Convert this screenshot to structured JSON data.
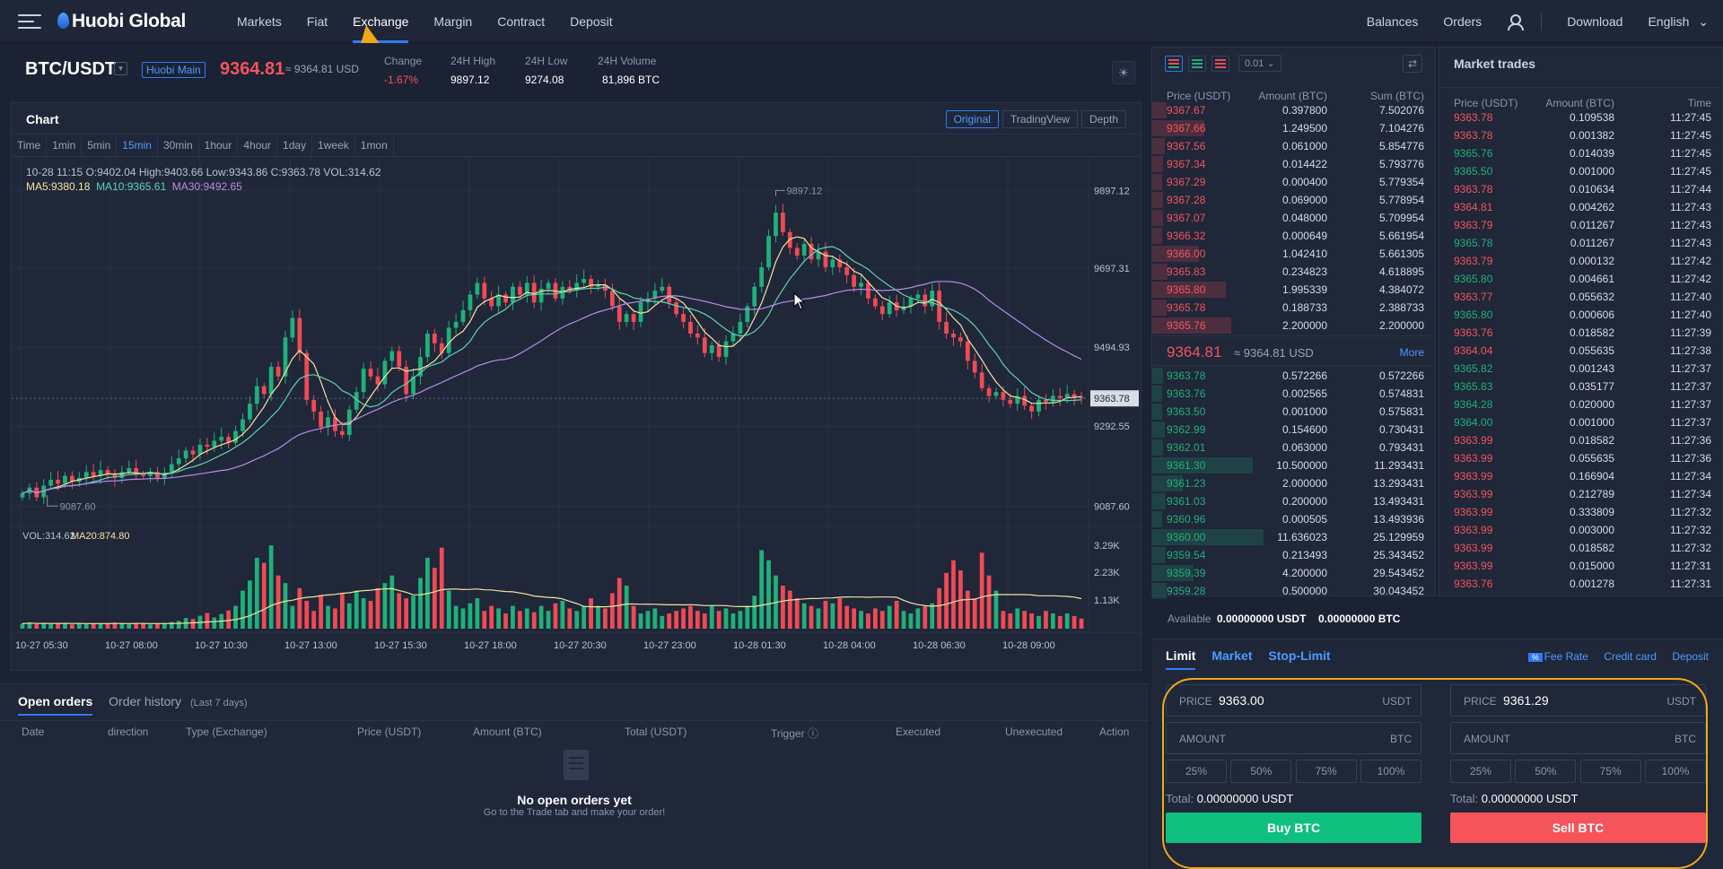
{
  "nav": {
    "logo": "Huobi Global",
    "items": [
      "Markets",
      "Fiat",
      "Exchange",
      "Margin",
      "Contract",
      "Deposit"
    ],
    "active": "Exchange",
    "right": [
      "Balances",
      "Orders",
      "Download",
      "English"
    ]
  },
  "ticker": {
    "pair": "BTC/USDT",
    "badge": "Huobi Main",
    "price": "9364.81",
    "usd": "≈ 9364.81 USD",
    "change_label": "Change",
    "change_value": "-1.67%",
    "high_label": "24H High",
    "high_value": "9897.12",
    "low_label": "24H Low",
    "low_value": "9274.08",
    "vol_label": "24H Volume",
    "vol_value": "81,896 BTC"
  },
  "chart": {
    "title": "Chart",
    "tabs": [
      "Original",
      "TradingView",
      "Depth"
    ],
    "intervals": [
      "Time",
      "1min",
      "5min",
      "15min",
      "30min",
      "1hour",
      "4hour",
      "1day",
      "1week",
      "1mon"
    ],
    "active_interval": "15min",
    "ohlc": "10-28 11:15   O:9402.04  High:9403.66  Low:9343.86  C:9363.78  VOL:314.62",
    "ma5": "MA5:9380.18",
    "ma10": "MA10:9365.61",
    "ma30": "MA30:9492.65",
    "vol_label": "VOL:314.62",
    "ma20_label": "MA20:874.80",
    "colors": {
      "up": "#20b07a",
      "down": "#f04a55",
      "ma5": "#f2e6a0",
      "ma10": "#5fd3b5",
      "ma30": "#b98be8"
    }
  },
  "chart_data": {
    "type": "candlestick",
    "title": "",
    "y_ticks": [
      9897.12,
      9697.31,
      9494.93,
      9292.55,
      9087.6
    ],
    "ylim": [
      9040,
      9960
    ],
    "vol_ticks": [
      "3.29K",
      "2.23K",
      "1.13K"
    ],
    "x_ticks": [
      "10-27 05:30",
      "10-27 08:00",
      "10-27 10:30",
      "10-27 13:00",
      "10-27 15:30",
      "10-27 18:00",
      "10-27 20:30",
      "10-27 23:00",
      "10-28 01:30",
      "10-28 04:00",
      "10-28 06:30",
      "10-28 09:00"
    ],
    "annotations": {
      "high": "9897.12",
      "low": "9087.60",
      "last": "9363.78"
    },
    "close": [
      9120,
      9135,
      9110,
      9140,
      9155,
      9145,
      9165,
      9150,
      9160,
      9175,
      9165,
      9180,
      9170,
      9160,
      9175,
      9185,
      9170,
      9165,
      9175,
      9160,
      9170,
      9195,
      9210,
      9230,
      9220,
      9245,
      9240,
      9255,
      9265,
      9250,
      9280,
      9310,
      9350,
      9395,
      9375,
      9445,
      9420,
      9520,
      9570,
      9480,
      9360,
      9330,
      9290,
      9315,
      9280,
      9270,
      9335,
      9380,
      9440,
      9420,
      9400,
      9460,
      9485,
      9445,
      9375,
      9420,
      9470,
      9530,
      9505,
      9480,
      9545,
      9560,
      9590,
      9630,
      9660,
      9620,
      9600,
      9630,
      9610,
      9650,
      9630,
      9660,
      9610,
      9645,
      9660,
      9620,
      9650,
      9640,
      9660,
      9670,
      9650,
      9655,
      9640,
      9600,
      9560,
      9580,
      9560,
      9610,
      9620,
      9640,
      9650,
      9610,
      9580,
      9560,
      9530,
      9520,
      9480,
      9500,
      9470,
      9510,
      9530,
      9560,
      9600,
      9650,
      9700,
      9780,
      9840,
      9790,
      9750,
      9730,
      9760,
      9720,
      9740,
      9700,
      9720,
      9700,
      9680,
      9650,
      9660,
      9620,
      9600,
      9580,
      9610,
      9590,
      9600,
      9620,
      9630,
      9600,
      9640,
      9560,
      9530,
      9520,
      9510,
      9460,
      9430,
      9390,
      9370,
      9380,
      9360,
      9350,
      9370,
      9345,
      9330,
      9360,
      9355,
      9370,
      9365,
      9375,
      9368,
      9363.78
    ],
    "volume": [
      200,
      240,
      180,
      210,
      190,
      220,
      230,
      170,
      200,
      180,
      210,
      190,
      200,
      240,
      210,
      180,
      230,
      200,
      170,
      190,
      220,
      260,
      310,
      420,
      380,
      510,
      620,
      440,
      580,
      720,
      900,
      1500,
      1900,
      2800,
      2600,
      3290,
      2100,
      1800,
      900,
      1600,
      1100,
      700,
      1300,
      900,
      800,
      1400,
      1000,
      1500,
      1200,
      1100,
      1600,
      1800,
      2100,
      1400,
      1200,
      1300,
      2000,
      2800,
      2400,
      3200,
      1500,
      900,
      800,
      1000,
      1200,
      700,
      900,
      800,
      600,
      900,
      700,
      800,
      650,
      900,
      700,
      1000,
      1100,
      800,
      700,
      900,
      1200,
      900,
      800,
      1400,
      2000,
      1700,
      900,
      600,
      700,
      800,
      500,
      600,
      700,
      800,
      900,
      700,
      600,
      900,
      700,
      800,
      600,
      700,
      900,
      1300,
      3100,
      2700,
      2100,
      1700,
      1500,
      1200,
      1000,
      900,
      800,
      1100,
      1000,
      1200,
      900,
      800,
      700,
      600,
      800,
      700,
      900,
      1100,
      700,
      600,
      800,
      900,
      1000,
      1600,
      2200,
      2700,
      2300,
      1500,
      1200,
      3000,
      2100,
      1500,
      700,
      600,
      800,
      700,
      600,
      500,
      700,
      600,
      500,
      600,
      500,
      400
    ]
  },
  "orders": {
    "tab_active": "Open orders",
    "tab_other": "Order history",
    "tab_note": "(Last 7 days)",
    "columns": [
      "Date",
      "direction",
      "Type (Exchange)",
      "Price (USDT)",
      "Amount (BTC)",
      "Total (USDT)",
      "Trigger ⓘ",
      "Executed",
      "Unexecuted",
      "Action"
    ],
    "empty_title": "No open orders yet",
    "empty_sub": "Go to the Trade tab and make your order!"
  },
  "orderbook": {
    "precision": "0.01",
    "columns": [
      "Price (USDT)",
      "Amount (BTC)",
      "Sum (BTC)"
    ],
    "asks": [
      [
        "9367.67",
        "0.397800",
        "7.502076",
        0.05
      ],
      [
        "9367.66",
        "1.249500",
        "7.104276",
        0.4
      ],
      [
        "9367.56",
        "0.061000",
        "5.854776",
        0.03
      ],
      [
        "9367.34",
        "0.014422",
        "5.793776",
        0.02
      ],
      [
        "9367.29",
        "0.000400",
        "5.779354",
        0.01
      ],
      [
        "9367.28",
        "0.069000",
        "5.778954",
        0.02
      ],
      [
        "9367.07",
        "0.048000",
        "5.709954",
        0.02
      ],
      [
        "9366.32",
        "0.000649",
        "5.661954",
        0.01
      ],
      [
        "9366.00",
        "1.042410",
        "5.661305",
        0.35
      ],
      [
        "9365.83",
        "0.234823",
        "4.618895",
        0.06
      ],
      [
        "9365.80",
        "1.995339",
        "4.384072",
        0.6
      ],
      [
        "9365.78",
        "0.188733",
        "2.388733",
        0.05
      ],
      [
        "9365.76",
        "2.200000",
        "2.200000",
        0.65
      ]
    ],
    "last_price": "9364.81",
    "last_usd": "≈ 9364.81 USD",
    "more": "More",
    "bids": [
      [
        "9363.78",
        "0.572266",
        "0.572266",
        0.02
      ],
      [
        "9363.76",
        "0.002565",
        "0.574831",
        0.01
      ],
      [
        "9363.50",
        "0.001000",
        "0.575831",
        0.01
      ],
      [
        "9362.99",
        "0.154600",
        "0.730431",
        0.03
      ],
      [
        "9362.01",
        "0.063000",
        "0.793431",
        0.02
      ],
      [
        "9361.30",
        "10.500000",
        "11.293431",
        0.85
      ],
      [
        "9361.23",
        "2.000000",
        "13.293431",
        0.2
      ],
      [
        "9361.03",
        "0.200000",
        "13.493431",
        0.04
      ],
      [
        "9360.96",
        "0.000505",
        "13.493936",
        0.01
      ],
      [
        "9360.00",
        "11.636023",
        "25.129959",
        0.95
      ],
      [
        "9359.54",
        "0.213493",
        "25.343452",
        0.04
      ],
      [
        "9359.39",
        "4.200000",
        "29.543452",
        0.3
      ],
      [
        "9359.28",
        "0.500000",
        "30.043452",
        0.05
      ]
    ]
  },
  "market_trades": {
    "title": "Market trades",
    "columns": [
      "Price (USDT)",
      "Amount (BTC)",
      "Time"
    ],
    "rows": [
      [
        "9363.78",
        "0.109538",
        "11:27:45",
        "down"
      ],
      [
        "9363.78",
        "0.001382",
        "11:27:45",
        "down"
      ],
      [
        "9365.76",
        "0.014039",
        "11:27:45",
        "up"
      ],
      [
        "9365.50",
        "0.001000",
        "11:27:45",
        "up"
      ],
      [
        "9363.78",
        "0.010634",
        "11:27:44",
        "down"
      ],
      [
        "9364.81",
        "0.004262",
        "11:27:43",
        "down"
      ],
      [
        "9363.79",
        "0.011267",
        "11:27:43",
        "down"
      ],
      [
        "9365.78",
        "0.011267",
        "11:27:43",
        "up"
      ],
      [
        "9363.79",
        "0.000132",
        "11:27:42",
        "down"
      ],
      [
        "9365.80",
        "0.004661",
        "11:27:42",
        "up"
      ],
      [
        "9363.77",
        "0.055632",
        "11:27:40",
        "down"
      ],
      [
        "9365.80",
        "0.000606",
        "11:27:40",
        "up"
      ],
      [
        "9363.76",
        "0.018582",
        "11:27:39",
        "down"
      ],
      [
        "9364.04",
        "0.055635",
        "11:27:38",
        "down"
      ],
      [
        "9365.82",
        "0.001243",
        "11:27:37",
        "up"
      ],
      [
        "9365.83",
        "0.035177",
        "11:27:37",
        "up"
      ],
      [
        "9364.28",
        "0.020000",
        "11:27:37",
        "up"
      ],
      [
        "9364.00",
        "0.001000",
        "11:27:37",
        "up"
      ],
      [
        "9363.99",
        "0.018582",
        "11:27:36",
        "down"
      ],
      [
        "9363.99",
        "0.055635",
        "11:27:36",
        "down"
      ],
      [
        "9363.99",
        "0.166904",
        "11:27:34",
        "down"
      ],
      [
        "9363.99",
        "0.212789",
        "11:27:34",
        "down"
      ],
      [
        "9363.99",
        "0.333809",
        "11:27:32",
        "down"
      ],
      [
        "9363.99",
        "0.003000",
        "11:27:32",
        "down"
      ],
      [
        "9363.99",
        "0.018582",
        "11:27:32",
        "down"
      ],
      [
        "9363.99",
        "0.015000",
        "11:27:31",
        "down"
      ],
      [
        "9363.76",
        "0.001278",
        "11:27:31",
        "down"
      ]
    ]
  },
  "available": {
    "label": "Available",
    "usdt": "0.00000000 USDT",
    "btc": "0.00000000 BTC"
  },
  "trade": {
    "tabs": [
      "Limit",
      "Market",
      "Stop-Limit"
    ],
    "fee_icon": "%",
    "links": [
      "Fee Rate",
      "Credit card",
      "Deposit"
    ],
    "price_label": "PRICE",
    "amount_label": "AMOUNT",
    "buy_price": "9363.00",
    "sell_price": "9361.29",
    "usdt": "USDT",
    "btc": "BTC",
    "pcts": [
      "25%",
      "50%",
      "75%",
      "100%"
    ],
    "total_label": "Total:",
    "total_value": "0.00000000 USDT",
    "buy_label": "Buy BTC",
    "sell_label": "Sell BTC"
  }
}
